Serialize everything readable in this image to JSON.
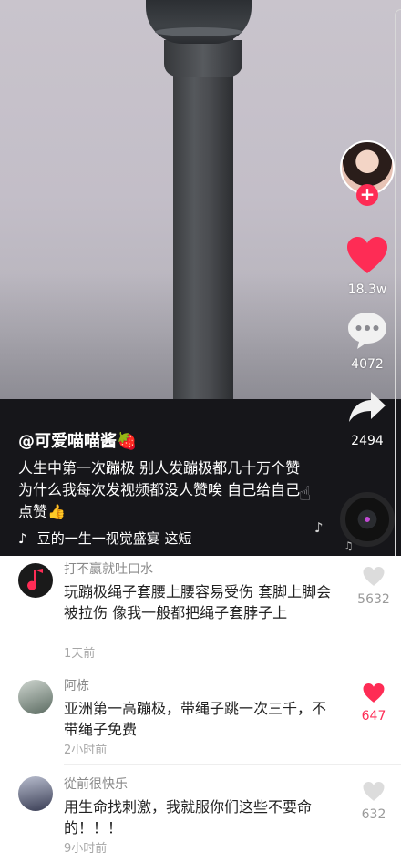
{
  "video": {
    "author": "@可爱喵喵酱🍓",
    "caption": "人生中第一次蹦极  别人发蹦极都几十万个赞  为什么我每次发视频都没人赞唉 自己给自己点赞👍",
    "music": "豆的一生一视觉盛宴     这短",
    "actions": {
      "likes": "18.3w",
      "comments": "4072",
      "shares": "2494"
    }
  },
  "comments": [
    {
      "name": "打不赢就吐口水",
      "text": "玩蹦极绳子套腰上腰容易受伤  套脚上脚会被拉伤  像我一般都把绳子套脖子上",
      "time": "1天前",
      "likes": "5632",
      "liked": false
    },
    {
      "name": "阿栋",
      "text": "亚洲第一高蹦极，带绳子跳一次三千，不带绳子免费",
      "time": "2小时前",
      "likes": "647",
      "liked": true
    },
    {
      "name": "從前很快乐",
      "text": "用生命找刺激，我就服你们这些不要命的！！！",
      "time": "9小时前",
      "likes": "632",
      "liked": false
    }
  ],
  "colors": {
    "accent": "#fe2c55",
    "dark_band": "#16161a",
    "muted_text": "#8a8a8a"
  },
  "icons": [
    "heart-icon",
    "comment-bubble-icon",
    "share-arrow-icon",
    "music-note-icon",
    "tiktok-logo-icon",
    "hand-icon"
  ]
}
